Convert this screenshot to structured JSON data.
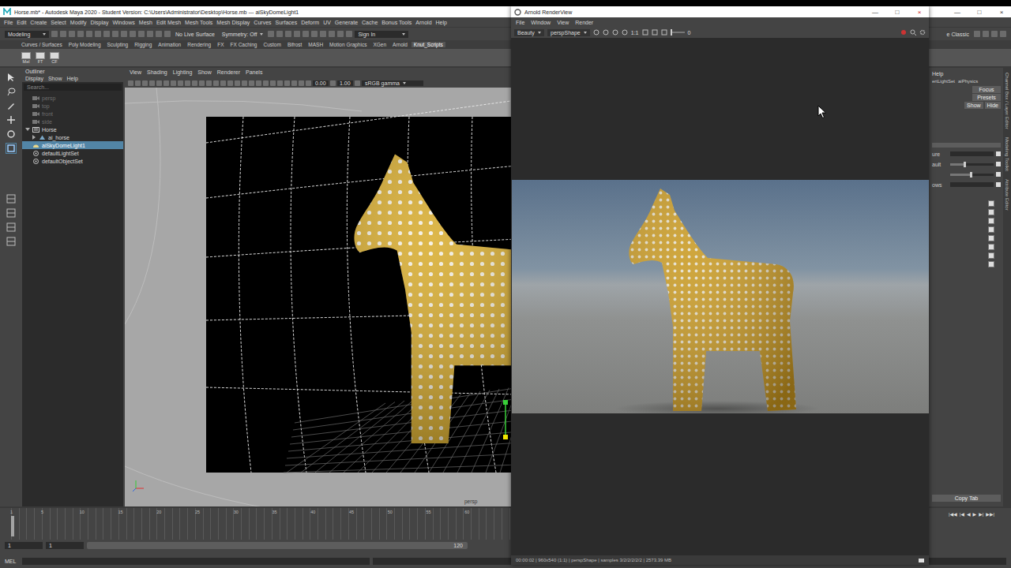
{
  "maya": {
    "title": "Horse.mb* - Autodesk Maya 2020 - Student Version: C:\\Users\\Administrator\\Desktop\\Horse.mb --- aiSkyDomeLight1",
    "window_buttons": [
      "—",
      "□",
      "×"
    ],
    "menu": [
      "File",
      "Edit",
      "Create",
      "Select",
      "Modify",
      "Display",
      "Windows",
      "Mesh",
      "Edit Mesh",
      "Mesh Tools",
      "Mesh Display",
      "Curves",
      "Surfaces",
      "Deform",
      "UV",
      "Generate",
      "Cache",
      "Bonus Tools",
      "Arnold",
      "Help"
    ],
    "toolbar": {
      "mode": "Modeling",
      "live_surface": "No Live Surface",
      "symmetry": "Symmetry: Off",
      "sign_in": "Sign In",
      "workspace": "e Classic"
    },
    "shelf_tabs": [
      {
        "label": "Curves / Surfaces",
        "selected": false
      },
      {
        "label": "Poly Modeling",
        "selected": false
      },
      {
        "label": "Sculpting",
        "selected": false
      },
      {
        "label": "Rigging",
        "selected": false
      },
      {
        "label": "Animation",
        "selected": false
      },
      {
        "label": "Rendering",
        "selected": false
      },
      {
        "label": "FX",
        "selected": false
      },
      {
        "label": "FX Caching",
        "selected": false
      },
      {
        "label": "Custom",
        "selected": false
      },
      {
        "label": "Bifrost",
        "selected": false
      },
      {
        "label": "MASH",
        "selected": false
      },
      {
        "label": "Motion Graphics",
        "selected": false
      },
      {
        "label": "XGen",
        "selected": false
      },
      {
        "label": "Arnold",
        "selected": false
      },
      {
        "label": "Knut_Scripts",
        "selected": true
      }
    ],
    "shelf_buttons": [
      "Mel",
      "FT",
      "CF"
    ]
  },
  "outliner": {
    "title": "Outliner",
    "menu": [
      "Display",
      "Show",
      "Help"
    ],
    "search": "Search...",
    "items": [
      {
        "label": "persp",
        "kind": "camera",
        "depth": 0,
        "dimmed": true,
        "selected": false,
        "has_children": false,
        "expanded": false
      },
      {
        "label": "top",
        "kind": "camera",
        "depth": 0,
        "dimmed": true,
        "selected": false,
        "has_children": false,
        "expanded": false
      },
      {
        "label": "front",
        "kind": "camera",
        "depth": 0,
        "dimmed": true,
        "selected": false,
        "has_children": false,
        "expanded": false
      },
      {
        "label": "side",
        "kind": "camera",
        "depth": 0,
        "dimmed": true,
        "selected": false,
        "has_children": false,
        "expanded": false
      },
      {
        "label": "Horse",
        "kind": "group",
        "depth": 0,
        "dimmed": false,
        "selected": false,
        "has_children": true,
        "expanded": true
      },
      {
        "label": "ai_horse",
        "kind": "mesh",
        "depth": 1,
        "dimmed": false,
        "selected": false,
        "has_children": true,
        "expanded": false
      },
      {
        "label": "aiSkyDomeLight1",
        "kind": "light",
        "depth": 0,
        "dimmed": false,
        "selected": true,
        "has_children": false,
        "expanded": false
      },
      {
        "label": "defaultLightSet",
        "kind": "set",
        "depth": 0,
        "dimmed": false,
        "selected": false,
        "has_children": false,
        "expanded": false
      },
      {
        "label": "defaultObjectSet",
        "kind": "set",
        "depth": 0,
        "dimmed": false,
        "selected": false,
        "has_children": false,
        "expanded": false
      }
    ]
  },
  "viewport": {
    "menu": [
      "View",
      "Shading",
      "Lighting",
      "Show",
      "Renderer",
      "Panels"
    ],
    "exposure": "0.00",
    "gamma": "1.00",
    "color_space": "sRGB gamma",
    "camera": "persp"
  },
  "right_panel": {
    "menu": "Help",
    "tabs": [
      "ertLightSet",
      "aiPhysics"
    ],
    "buttons": [
      "Focus",
      "Presets"
    ],
    "toggle": [
      "Show",
      "Hide"
    ],
    "rows": [
      {
        "label": "ure",
        "kind": "field",
        "level": 0
      },
      {
        "label": "ault",
        "kind": "slider",
        "level": 0.3
      },
      {
        "label": "",
        "kind": "slider",
        "level": 0.45
      },
      {
        "label": "ows",
        "kind": "field",
        "level": 0
      }
    ],
    "checkboxes": [
      true,
      true,
      true,
      true,
      true,
      true,
      true,
      true
    ],
    "copy_tab": "Copy Tab",
    "side_tabs": [
      "Channel Box / Layer Editor",
      "Modeling Toolkit",
      "Attribute Editor"
    ]
  },
  "timeline": {
    "ticks": [
      "1",
      "5",
      "10",
      "15",
      "20",
      "25",
      "30",
      "35",
      "40",
      "45",
      "50",
      "55",
      "60"
    ],
    "current_frame": "1",
    "playback": [
      "|◀◀",
      "|◀",
      "◀",
      "▶",
      "▶|",
      "▶▶|"
    ],
    "range": {
      "start": "1",
      "inner_start": "1",
      "inner_end": "120"
    }
  },
  "command_line": {
    "language": "MEL"
  },
  "render_view": {
    "title": "Arnold RenderView",
    "window_buttons": [
      "—",
      "□",
      "×"
    ],
    "menu": [
      "File",
      "Window",
      "View",
      "Render"
    ],
    "aov": "Beauty",
    "camera": "perspShape",
    "zoom": "1:1",
    "exposure": "0",
    "status": "00:00:02 | 960x540 (1:1) | perspShape | samples 3/2/2/2/2/2 | 2573.39 MB"
  }
}
